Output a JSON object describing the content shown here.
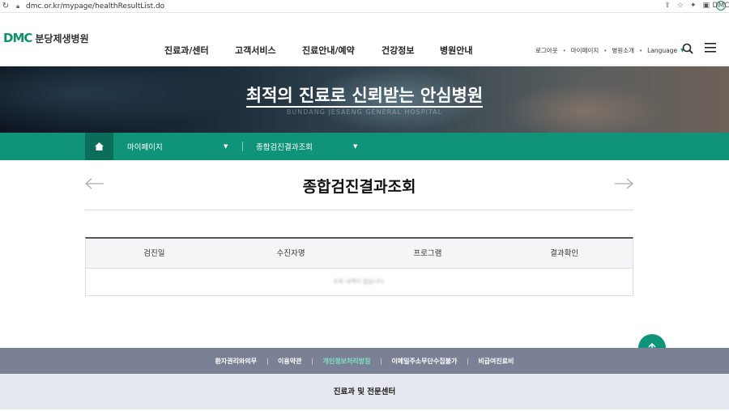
{
  "browser": {
    "url": "dmc.or.kr/mypage/healthResultList.do",
    "profile_initials": "DMC"
  },
  "header": {
    "logo_mark": "DMC",
    "logo_text": "분당제생병원",
    "nav": [
      "진료과/센터",
      "고객서비스",
      "진료안내/예약",
      "건강정보",
      "병원안내"
    ],
    "util": {
      "logout": "로그아웃",
      "mypage": "마이페이지",
      "intro": "병원소개",
      "language": "Language"
    }
  },
  "banner": {
    "title": "최적의 진료로 신뢰받는 안심병원",
    "subtitle": "BUNDANG JESAENG GENERAL HOSPITAL"
  },
  "location": {
    "level1": "마이페이지",
    "level2": "종합검진결과조회"
  },
  "page": {
    "title": "종합검진결과조회"
  },
  "table": {
    "headers": [
      "검진일",
      "수진자명",
      "프로그램",
      "결과확인"
    ],
    "empty_message": "조회 내역이 없습니다."
  },
  "footer": {
    "links": [
      "환자권리와의무",
      "이용약관",
      "개인정보처리방침",
      "이메일주소무단수집불가",
      "비급여진료비"
    ],
    "active_link_index": 2,
    "center_title": "진료과 및 전문센터"
  },
  "colors": {
    "brand_green": "#0f9479",
    "footer_bar": "#7a8195",
    "footer_active": "#7fe3c2"
  }
}
